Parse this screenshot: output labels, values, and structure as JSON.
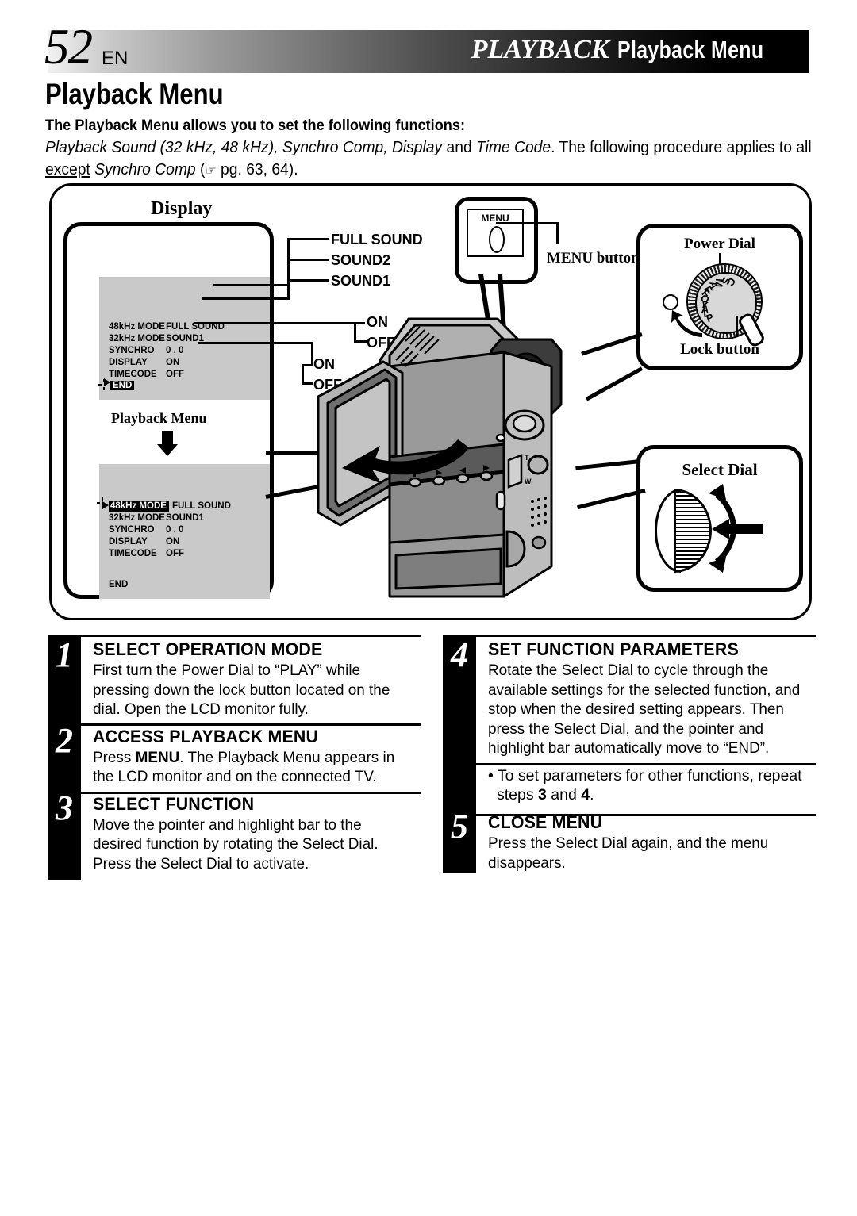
{
  "header": {
    "page_number": "52",
    "language": "EN",
    "chapter": "PLAYBACK",
    "topic": "Playback Menu"
  },
  "page_title": "Playback Menu",
  "intro": {
    "bold_line": "The Playback Menu allows you to set the following functions:",
    "body_part1": "Playback Sound (32 kHz, 48 kHz), Synchro Comp, Display",
    "body_and": " and ",
    "body_part2": "Time Code",
    "body_part3": ". The following procedure applies to all ",
    "body_except": "except",
    "body_part4": " Synchro Comp",
    "body_hand": "☞",
    "body_part5": " pg. 63, 64)."
  },
  "illustration": {
    "display_label": "Display",
    "playback_menu_label": "Playback Menu",
    "menu_screen_1": {
      "rows": [
        {
          "label": "48kHz  MODE",
          "value": "FULL SOUND",
          "highlighted": false
        },
        {
          "label": "32kHz  MODE",
          "value": "SOUND1",
          "highlighted": false
        },
        {
          "label": "SYNCHRO",
          "value": "0 . 0",
          "highlighted": false
        },
        {
          "label": "DISPLAY",
          "value": "ON",
          "highlighted": false
        },
        {
          "label": "TIMECODE",
          "value": "OFF",
          "highlighted": false
        }
      ],
      "end_label": "END",
      "end_highlighted": true
    },
    "menu_screen_2": {
      "rows": [
        {
          "label": "48kHz  MODE",
          "value": "FULL SOUND",
          "highlighted": true
        },
        {
          "label": "32kHz  MODE",
          "value": "SOUND1",
          "highlighted": false
        },
        {
          "label": "SYNCHRO",
          "value": "0 . 0",
          "highlighted": false
        },
        {
          "label": "DISPLAY",
          "value": "ON",
          "highlighted": false
        },
        {
          "label": "TIMECODE",
          "value": "OFF",
          "highlighted": false
        }
      ],
      "end_label": "END",
      "end_highlighted": false
    },
    "options": {
      "sound_full": "FULL SOUND",
      "sound_2": "SOUND2",
      "sound_1": "SOUND1",
      "display_on": "ON",
      "display_off": "OFF",
      "timecode_on": "ON",
      "timecode_off": "OFF"
    },
    "menu_button_word": "MENU",
    "menu_button_label": "MENU button",
    "power_dial_label": "Power Dial",
    "lock_button_label": "Lock button",
    "select_dial_label": "Select Dial",
    "power_dial_positions": [
      "P",
      "L",
      "A",
      "Y",
      "O",
      "F",
      "F",
      "A",
      "M",
      "S",
      "C"
    ]
  },
  "steps": [
    {
      "number": "1",
      "heading": "SELECT OPERATION MODE",
      "body": "First turn the Power Dial to “PLAY” while pressing down the lock button located on the dial. Open the LCD monitor fully."
    },
    {
      "number": "2",
      "heading": "ACCESS PLAYBACK MENU",
      "body_pre": "Press ",
      "body_bold": "MENU",
      "body_post": ". The Playback Menu appears in the LCD monitor and on the connected TV."
    },
    {
      "number": "3",
      "heading": "SELECT FUNCTION",
      "body": "Move the pointer and highlight bar to the desired function by rotating the Select Dial. Press the Select Dial to activate."
    },
    {
      "number": "4",
      "heading": "SET FUNCTION PARAMETERS",
      "body": "Rotate the Select Dial to cycle through the available settings for the selected function, and stop when the desired setting appears. Then press the Select Dial, and the pointer and highlight bar automatically move to “END”."
    },
    {
      "number": "5",
      "heading": "CLOSE MENU",
      "body": "Press the Select Dial again, and the menu disappears."
    }
  ],
  "note": {
    "pre": "• To set parameters for other functions, repeat steps ",
    "b1": "3",
    "mid": " and ",
    "b2": "4",
    "post": "."
  },
  "colors": {
    "ink": "#000000",
    "lcd_background": "#c9c9c9",
    "header_gradient_start": "#f2f2f2",
    "header_gradient_end": "#000000"
  }
}
